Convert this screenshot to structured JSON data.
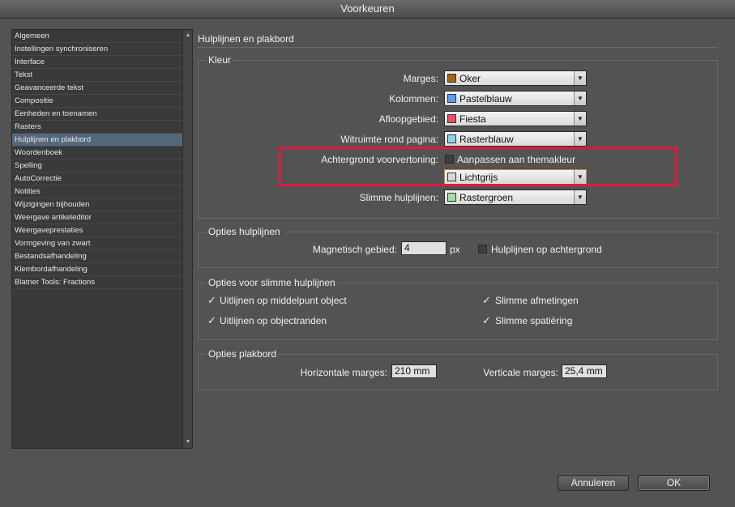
{
  "window": {
    "title": "Voorkeuren"
  },
  "sidebar": {
    "items": [
      {
        "label": "Algemeen"
      },
      {
        "label": "Instellingen synchroniseren"
      },
      {
        "label": "Interface"
      },
      {
        "label": "Tekst"
      },
      {
        "label": "Geavanceerde tekst"
      },
      {
        "label": "Compositie"
      },
      {
        "label": "Eenheden en toenamen"
      },
      {
        "label": "Rasters"
      },
      {
        "label": "Hulplijnen en plakbord",
        "selected": true
      },
      {
        "label": "Woordenboek"
      },
      {
        "label": "Spelling"
      },
      {
        "label": "AutoCorrectie"
      },
      {
        "label": "Notities"
      },
      {
        "label": "Wijzigingen bijhouden"
      },
      {
        "label": "Weergave artikeleditor"
      },
      {
        "label": "Weergaveprestaties"
      },
      {
        "label": "Vormgeving van zwart"
      },
      {
        "label": "Bestandsafhandeling"
      },
      {
        "label": "Klembordafhandeling"
      },
      {
        "label": "Blatner Tools: Fractions"
      }
    ]
  },
  "main": {
    "title": "Hulplijnen en plakbord",
    "kleur": {
      "title": "Kleur",
      "marges": {
        "label": "Marges:",
        "value": "Oker",
        "color": "#a8650e"
      },
      "kolommen": {
        "label": "Kolommen:",
        "value": "Pastelblauw",
        "color": "#5b9cf0"
      },
      "afloop": {
        "label": "Afloopgebied:",
        "value": "Fiesta",
        "color": "#ee4e60"
      },
      "witruimte": {
        "label": "Witruimte rond pagina:",
        "value": "Rasterblauw",
        "color": "#8ccff0"
      },
      "achtergrond": {
        "label": "Achtergrond voorvertoning:",
        "checkbox_label": "Aanpassen aan themakleur",
        "checked": false,
        "value": "Lichtgrijs",
        "color": "#d8d8d8"
      },
      "slimme": {
        "label": "Slimme hulplijnen:",
        "value": "Rastergroen",
        "color": "#9ee0a0"
      },
      "highlight_color": "#e0193d"
    },
    "opties_hulplijnen": {
      "title": "Opties hulplijnen",
      "magnetisch_label": "Magnetisch gebied:",
      "magnetisch_value": "4",
      "unit": "px",
      "achtergrond_label": "Hulplijnen op achtergrond",
      "achtergrond_checked": false
    },
    "opties_slimme": {
      "title": "Opties voor slimme hulplijnen",
      "middelpunt": {
        "label": "Uitlijnen op middelpunt object",
        "checked": true
      },
      "objectranden": {
        "label": "Uitlijnen op objectranden",
        "checked": true
      },
      "afmetingen": {
        "label": "Slimme afmetingen",
        "checked": true
      },
      "spatiering": {
        "label": "Slimme spatiëring",
        "checked": true
      }
    },
    "opties_plakbord": {
      "title": "Opties plakbord",
      "horizontaal_label": "Horizontale marges:",
      "horizontaal_value": "210 mm",
      "verticaal_label": "Verticale marges:",
      "verticaal_value": "25,4 mm"
    }
  },
  "buttons": {
    "cancel": "Annuleren",
    "ok": "OK"
  }
}
